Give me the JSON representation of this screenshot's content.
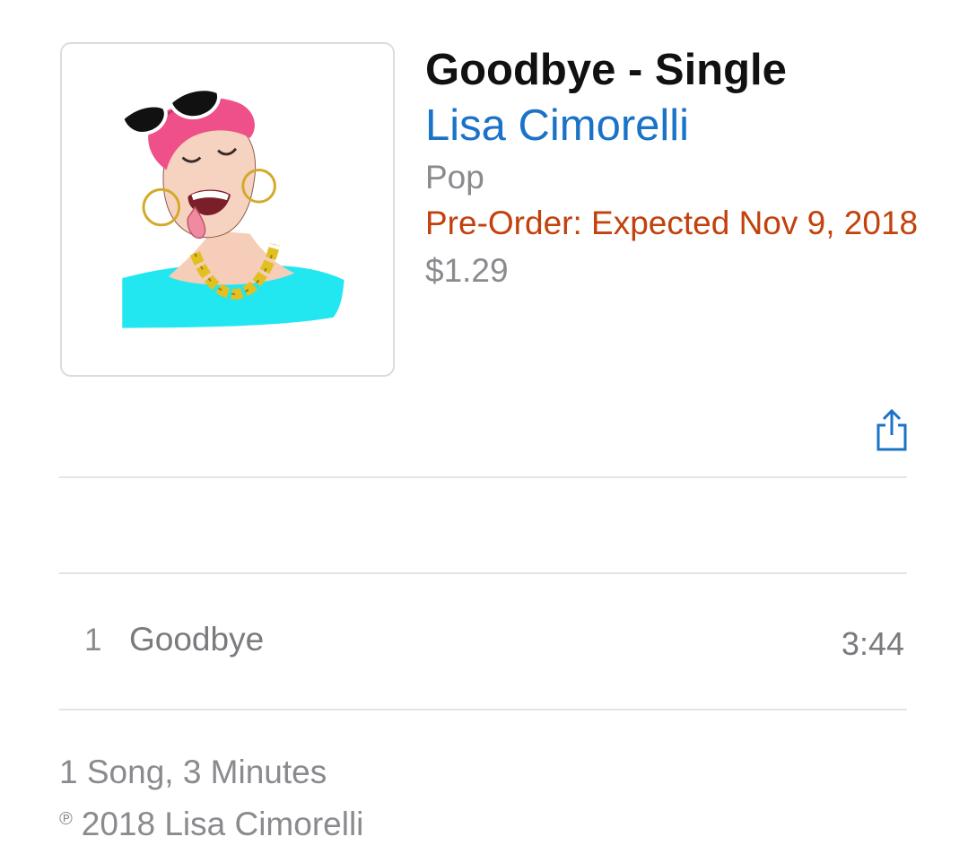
{
  "album": {
    "title": "Goodbye - Single",
    "artist": "Lisa Cimorelli",
    "genre": "Pop",
    "preorder": "Pre-Order: Expected Nov 9, 2018",
    "price": "$1.29",
    "artwork_icon": "album-artwork"
  },
  "actions": {
    "share_icon": "share-icon"
  },
  "tracks": [
    {
      "number": "1",
      "name": "Goodbye",
      "duration": "3:44"
    }
  ],
  "footer": {
    "summary": "1 Song, 3 Minutes",
    "copyright_symbol": "℗",
    "copyright": "2018 Lisa Cimorelli"
  },
  "colors": {
    "artist_link": "#1a73c7",
    "preorder": "#c2410c",
    "secondary_text": "#8a8a8f",
    "share_icon": "#1a73c7"
  }
}
